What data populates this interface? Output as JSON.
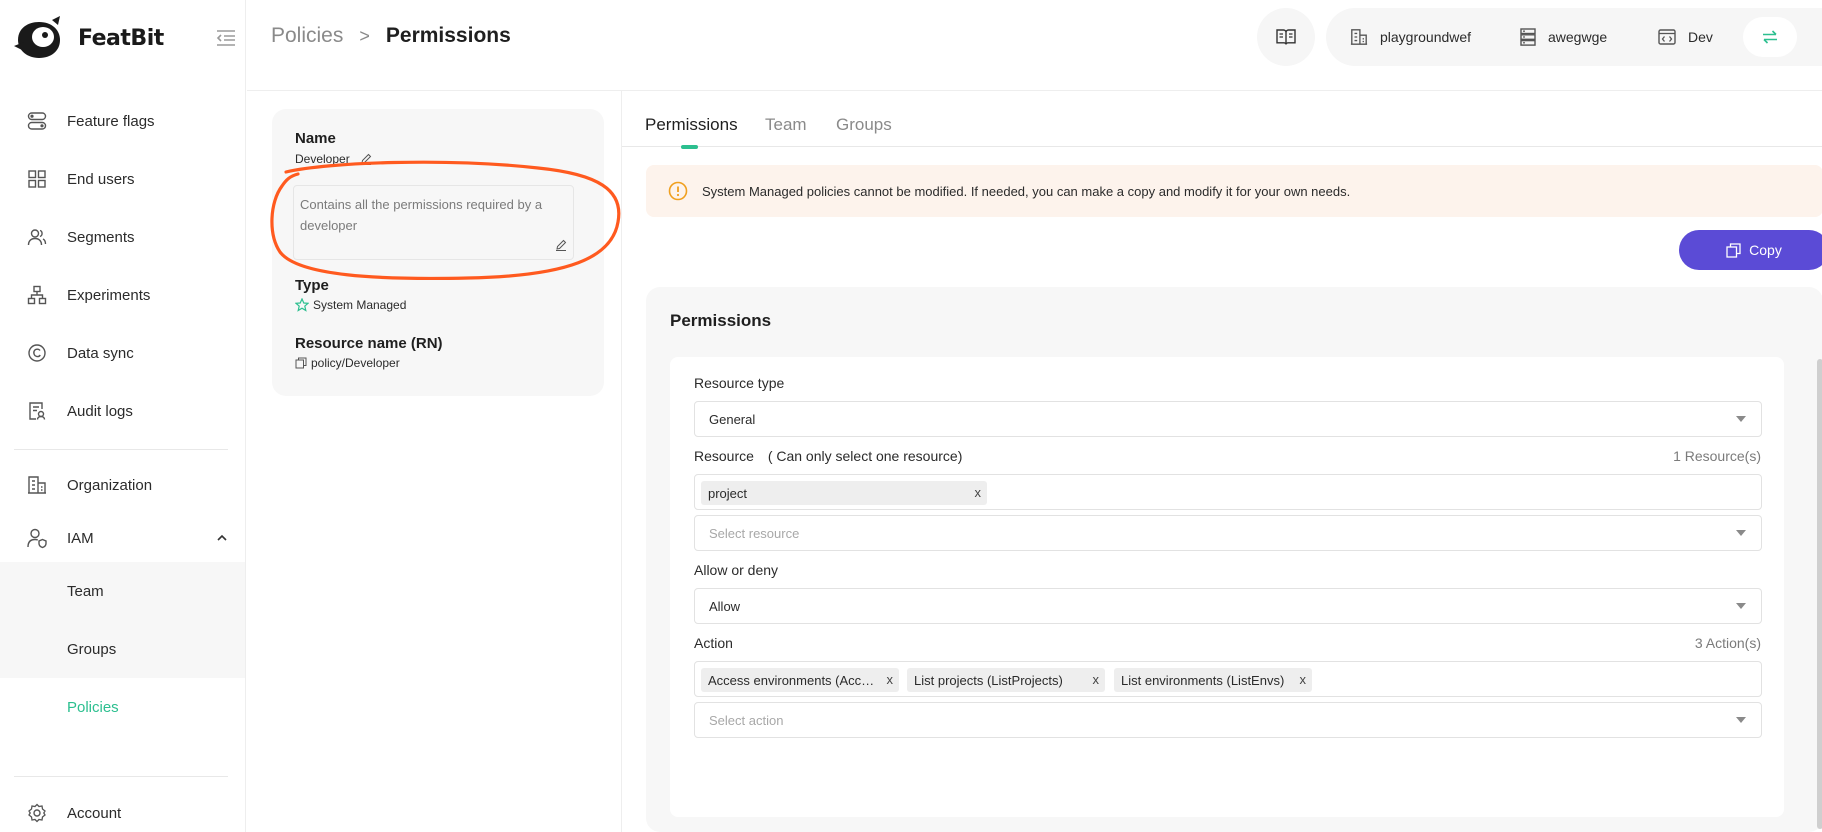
{
  "app": {
    "name": "FeatBit"
  },
  "sidebar": {
    "items": [
      {
        "label": "Feature flags"
      },
      {
        "label": "End users"
      },
      {
        "label": "Segments"
      },
      {
        "label": "Experiments"
      },
      {
        "label": "Data sync"
      },
      {
        "label": "Audit logs"
      },
      {
        "label": "Organization"
      },
      {
        "label": "IAM"
      }
    ],
    "iam_sub": [
      {
        "label": "Team"
      },
      {
        "label": "Groups"
      },
      {
        "label": "Policies"
      }
    ],
    "account": "Account"
  },
  "header": {
    "breadcrumb_parent": "Policies",
    "breadcrumb_sep": ">",
    "breadcrumb_current": "Permissions",
    "organization": "playgroundwef",
    "project": "awegwge",
    "environment": "Dev"
  },
  "policy": {
    "name_title": "Name",
    "name": "Developer",
    "description": "Contains all the permissions required by a developer",
    "type_title": "Type",
    "type": "System Managed",
    "rn_title": "Resource name (RN)",
    "rn": "policy/Developer"
  },
  "tabs": [
    {
      "label": "Permissions"
    },
    {
      "label": "Team"
    },
    {
      "label": "Groups"
    }
  ],
  "alert": {
    "text": "System Managed policies cannot be modified. If needed, you can make a copy and modify it for your own needs."
  },
  "copy_button": "Copy",
  "permissions": {
    "title": "Permissions",
    "resource_type_label": "Resource type",
    "resource_type_value": "General",
    "resource_label": "Resource",
    "resource_hint": "( Can only select one resource)",
    "resource_count": "1 Resource(s)",
    "resources": [
      "project"
    ],
    "resource_placeholder": "Select resource",
    "effect_label": "Allow or deny",
    "effect_value": "Allow",
    "action_label": "Action",
    "action_count": "3 Action(s)",
    "actions": [
      "Access environments (AccessEnvs)",
      "List projects (ListProjects)",
      "List environments (ListEnvs)"
    ],
    "action_placeholder": "Select action",
    "remove_glyph": "x"
  },
  "colors": {
    "brand": "#5b4bd6",
    "accent": "#2cbf8f",
    "annotation": "#ff5a1f",
    "warning": "#f0a020"
  }
}
